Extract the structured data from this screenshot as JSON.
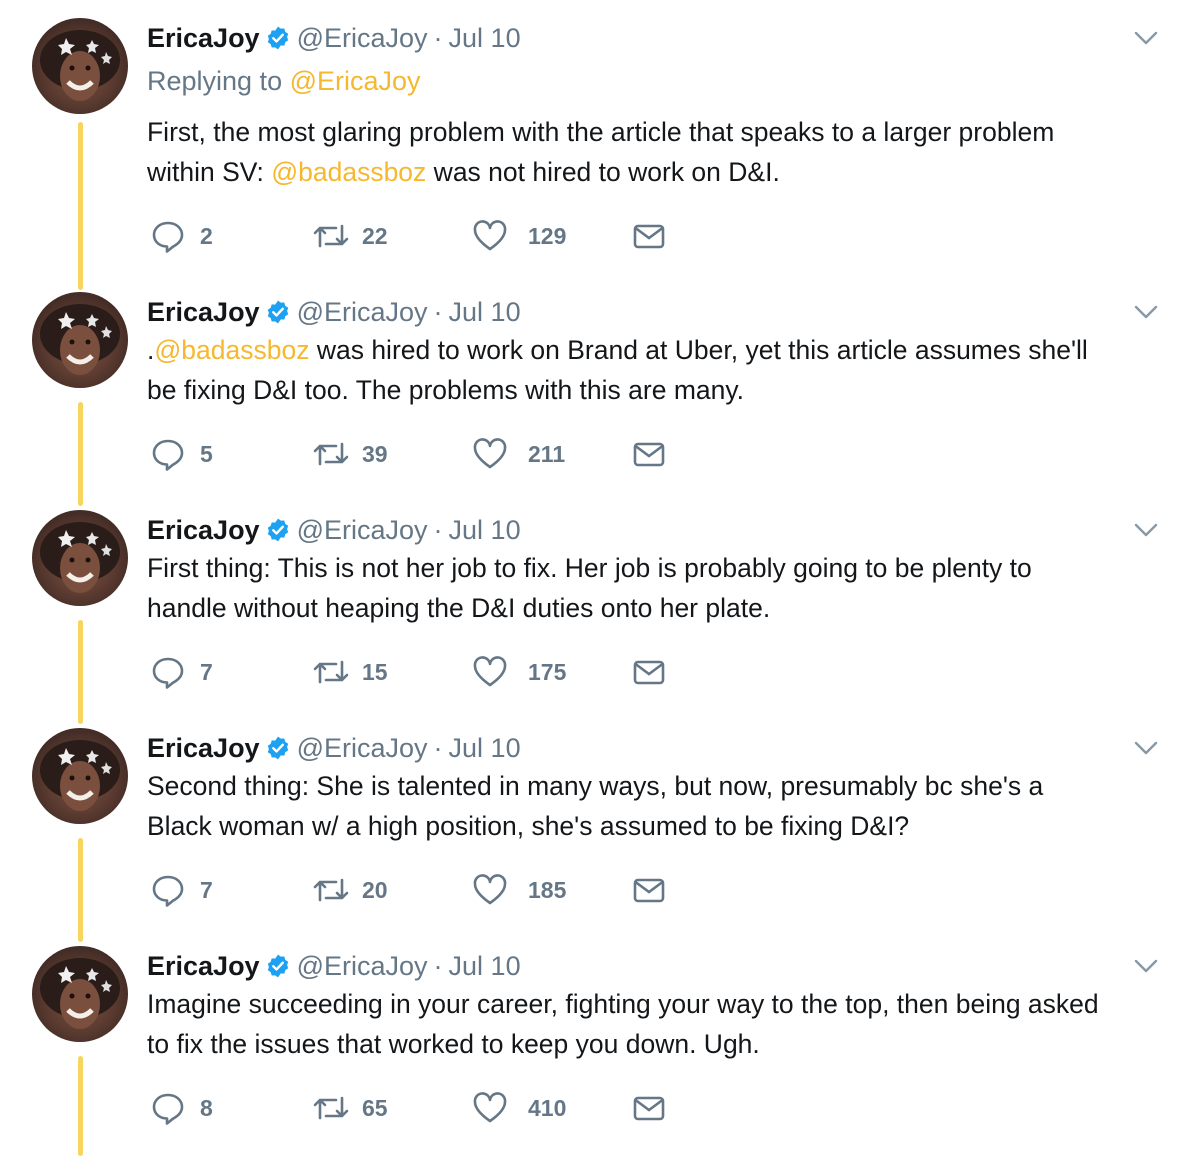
{
  "author": {
    "name": "EricaJoy",
    "handle": "@EricaJoy",
    "separator": "·"
  },
  "colors": {
    "mention": "#f5b82e",
    "thread_line": "#f8d55f",
    "verified": "#1da1f2",
    "muted": "#657786"
  },
  "tweets": [
    {
      "date": "Jul 10",
      "replying_label": "Replying to",
      "replying_to": "@EricaJoy",
      "line1_pre": "First, the most glaring problem with the article that speaks to a larger problem",
      "line2_pre": "within SV: ",
      "mention": "@badassboz",
      "line2_post": " was not hired to work on D&I.",
      "replies": "2",
      "retweets": "22",
      "likes": "129"
    },
    {
      "date": "Jul 10",
      "prefix": ".",
      "mention": "@badassboz",
      "line1_post": " was hired to work on Brand at Uber, yet this article assumes she'll",
      "line2": "be fixing D&I too. The problems with this are many.",
      "replies": "5",
      "retweets": "39",
      "likes": "211"
    },
    {
      "date": "Jul 10",
      "line1": "First thing: This is not her job to fix. Her job is probably going to be plenty to",
      "line2": "handle without heaping the D&I duties onto her plate.",
      "replies": "7",
      "retweets": "15",
      "likes": "175"
    },
    {
      "date": "Jul 10",
      "line1": "Second thing: She is talented in many ways, but now, presumably bc she's a",
      "line2": "Black woman w/ a high position, she's assumed to be fixing D&I?",
      "replies": "7",
      "retweets": "20",
      "likes": "185"
    },
    {
      "date": "Jul 10",
      "line1": "Imagine succeeding in your career, fighting your way to the top, then being asked",
      "line2": "to fix the issues that worked to keep you down. Ugh.",
      "replies": "8",
      "retweets": "65",
      "likes": "410"
    }
  ],
  "icons": {
    "reply": "reply-icon",
    "retweet": "retweet-icon",
    "like": "heart-icon",
    "dm": "envelope-icon",
    "more": "chevron-down-icon",
    "verified": "verified-badge-icon"
  }
}
